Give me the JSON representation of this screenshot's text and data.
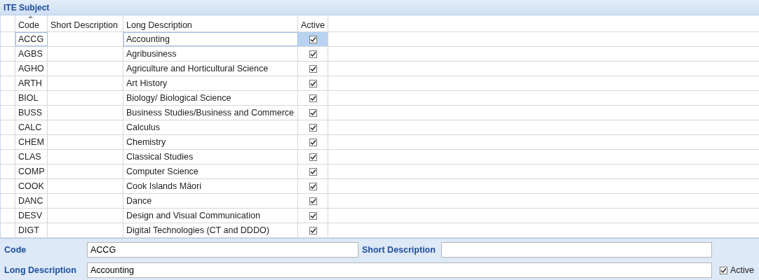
{
  "window": {
    "title": "ITE Subject"
  },
  "table": {
    "columns": [
      {
        "label": "Code",
        "sorted": true
      },
      {
        "label": "Short Description",
        "sorted": false
      },
      {
        "label": "Long Description",
        "sorted": false
      },
      {
        "label": "Active",
        "sorted": false
      }
    ],
    "rows": [
      {
        "code": "ACCG",
        "long": "Accounting",
        "active": true,
        "selected": true
      },
      {
        "code": "AGBS",
        "long": "Agribusiness",
        "active": true,
        "selected": false
      },
      {
        "code": "AGHO",
        "long": "Agriculture and Horticultural Science",
        "active": true,
        "selected": false
      },
      {
        "code": "ARTH",
        "long": "Art History",
        "active": true,
        "selected": false
      },
      {
        "code": "BIOL",
        "long": "Biology/ Biological Science",
        "active": true,
        "selected": false
      },
      {
        "code": "BUSS",
        "long": "Business Studies/Business and Commerce",
        "active": true,
        "selected": false
      },
      {
        "code": "CALC",
        "long": "Calculus",
        "active": true,
        "selected": false
      },
      {
        "code": "CHEM",
        "long": "Chemistry",
        "active": true,
        "selected": false
      },
      {
        "code": "CLAS",
        "long": "Classical Studies",
        "active": true,
        "selected": false
      },
      {
        "code": "COMP",
        "long": "Computer Science",
        "active": true,
        "selected": false
      },
      {
        "code": "COOK",
        "long": "Cook Islands Māori",
        "active": true,
        "selected": false
      },
      {
        "code": "DANC",
        "long": "Dance",
        "active": true,
        "selected": false
      },
      {
        "code": "DESV",
        "long": "Design and Visual Communication",
        "active": true,
        "selected": false
      },
      {
        "code": "DIGT",
        "long": "Digital Technologies (CT and DDDO)",
        "active": true,
        "selected": false
      }
    ]
  },
  "form": {
    "code_label": "Code",
    "code_value": "ACCG",
    "short_label": "Short Description",
    "long_label": "Long Description",
    "long_value": "Accounting",
    "active_label": "Active",
    "active": true
  }
}
